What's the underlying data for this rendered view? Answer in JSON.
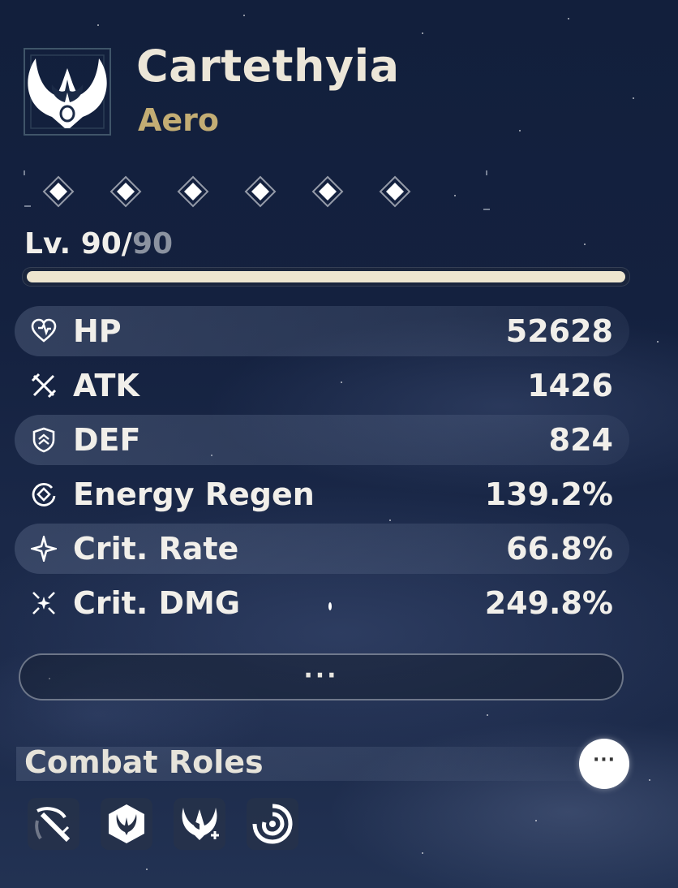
{
  "character": {
    "name": "Cartethyia",
    "element": "Aero"
  },
  "sequence": {
    "unlocked": 6,
    "total": 6
  },
  "level": {
    "current": "90",
    "separator": "/",
    "max": "90",
    "prefix": "Lv. "
  },
  "xp_progress": 1.0,
  "stats": [
    {
      "icon": "heart-icon",
      "label": "HP",
      "value": "52628"
    },
    {
      "icon": "crossed-swords-icon",
      "label": "ATK",
      "value": "1426"
    },
    {
      "icon": "shield-icon",
      "label": "DEF",
      "value": "824"
    },
    {
      "icon": "energy-regen-icon",
      "label": "Energy Regen",
      "value": "139.2%"
    },
    {
      "icon": "sparkle-icon",
      "label": "Crit. Rate",
      "value": "66.8%"
    },
    {
      "icon": "crit-dmg-icon",
      "label": "Crit. DMG",
      "value": "249.8%"
    }
  ],
  "more_button": {
    "label": "···"
  },
  "combat_roles": {
    "title": "Combat Roles",
    "more_label": "···",
    "roles": [
      {
        "icon": "greatsword-icon"
      },
      {
        "icon": "crest-hexagon-icon"
      },
      {
        "icon": "crest-plus-icon"
      },
      {
        "icon": "aero-swirl-icon"
      }
    ]
  },
  "colors": {
    "element_gold": "#c3ad74",
    "text_light": "#f1efea",
    "level_max_gray": "#8b92a0"
  }
}
